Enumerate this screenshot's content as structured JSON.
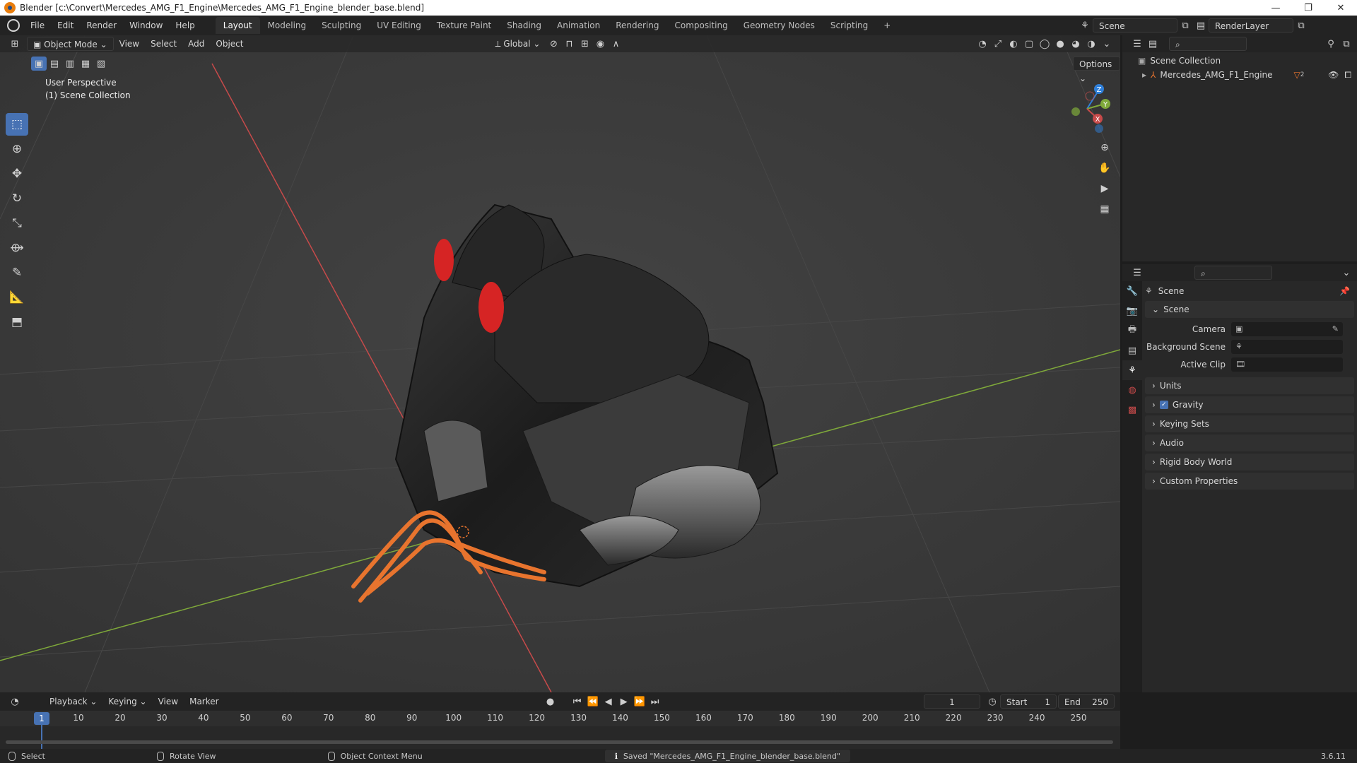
{
  "window": {
    "title": "Blender [c:\\Convert\\Mercedes_AMG_F1_Engine\\Mercedes_AMG_F1_Engine_blender_base.blend]",
    "controls": {
      "minimize": "—",
      "maximize": "❐",
      "close": "✕"
    }
  },
  "menus": [
    "File",
    "Edit",
    "Render",
    "Window",
    "Help"
  ],
  "workspaces": {
    "active": "Layout",
    "tabs": [
      "Layout",
      "Modeling",
      "Sculpting",
      "UV Editing",
      "Texture Paint",
      "Shading",
      "Animation",
      "Rendering",
      "Compositing",
      "Geometry Nodes",
      "Scripting"
    ],
    "add": "+"
  },
  "scene_selector": {
    "value": "Scene"
  },
  "view_layer_selector": {
    "value": "RenderLayer"
  },
  "viewport": {
    "mode": "Object Mode",
    "menus": [
      "View",
      "Select",
      "Add",
      "Object"
    ],
    "orientation": "Global",
    "options_label": "Options",
    "info_line1": "User Perspective",
    "info_line2": "(1) Scene Collection",
    "gizmo": {
      "z": "Z",
      "y": "Y",
      "x": "X"
    }
  },
  "outliner": {
    "root": "Scene Collection",
    "items": [
      {
        "name": "Mercedes_AMG_F1_Engine",
        "badge": "2"
      }
    ]
  },
  "properties": {
    "header_title": "Scene",
    "section": "Scene",
    "fields": [
      {
        "label": "Camera",
        "value": ""
      },
      {
        "label": "Background Scene",
        "value": ""
      },
      {
        "label": "Active Clip",
        "value": ""
      }
    ],
    "panels": [
      "Units",
      "Gravity",
      "Keying Sets",
      "Audio",
      "Rigid Body World",
      "Custom Properties"
    ],
    "gravity_checked": true
  },
  "timeline": {
    "menus": [
      "Playback",
      "Keying",
      "View",
      "Marker"
    ],
    "current_frame": "1",
    "start_label": "Start",
    "start": "1",
    "end_label": "End",
    "end": "250",
    "ruler": [
      "1",
      "10",
      "20",
      "30",
      "40",
      "50",
      "60",
      "70",
      "80",
      "90",
      "100",
      "110",
      "120",
      "130",
      "140",
      "150",
      "160",
      "170",
      "180",
      "190",
      "200",
      "210",
      "220",
      "230",
      "240",
      "250"
    ]
  },
  "statusbar": {
    "select": "Select",
    "rotate": "Rotate View",
    "context": "Object Context Menu",
    "message": "Saved \"Mercedes_AMG_F1_Engine_blender_base.blend\"",
    "version": "3.6.11"
  },
  "colors": {
    "accent": "#4772b3",
    "x_axis": "#c74a4a",
    "y_axis": "#7fa93a",
    "engine_red": "#d62424",
    "wiring": "#e8742e"
  }
}
